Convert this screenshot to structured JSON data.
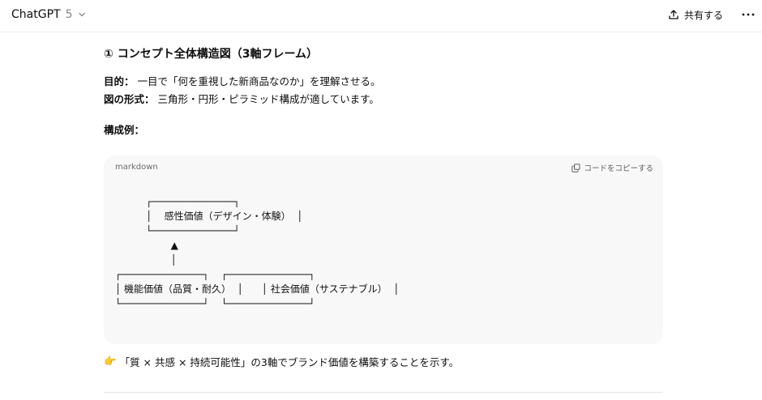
{
  "header": {
    "model_name": "ChatGPT",
    "model_version": "5",
    "share_label": "共有する"
  },
  "message": {
    "section_title": "① コンセプト全体構造図（3軸フレーム）",
    "purpose_label": "目的：",
    "purpose_text": " 一目で「何を重視した新商品なのか」を理解させる。",
    "format_label": "図の形式：",
    "format_text": " 三角形・円形・ピラミッド構成が適しています。",
    "example_label": "構成例："
  },
  "code_block": {
    "language": "markdown",
    "copy_label": "コードをコピーする",
    "content": "          ┌──────────────┐\n          │    感性価値（デザイン・体験）  │\n          └──────────────┘\n                  ▲\n                  │\n┌──────────────┐    ┌──────────────┐\n│ 機能価値（品質・耐久）  │      │ 社会価値（サステナブル）  │\n└──────────────┘    └──────────────┘"
  },
  "footer": {
    "pointer_emoji": "👉",
    "text": "「質 × 共感 × 持続可能性」の3軸でブランド価値を構築することを示す。"
  },
  "colors": {
    "code_bg": "#f8f8f8",
    "muted_text": "#8a8a8a",
    "divider": "#ececec"
  }
}
